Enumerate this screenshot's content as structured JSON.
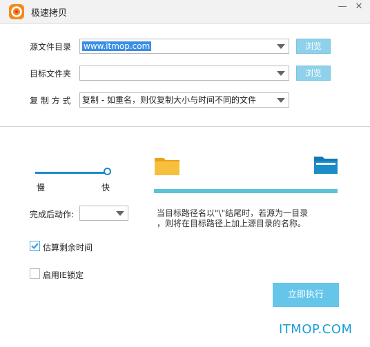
{
  "window": {
    "title": "极速拷贝",
    "minimize_glyph": "—",
    "close_glyph": "✕"
  },
  "source": {
    "label": "源文件目录",
    "value": "www.itmop.com",
    "browse_label": "浏览"
  },
  "target": {
    "label": "目标文件夹",
    "value": "",
    "browse_label": "浏览"
  },
  "copy_mode": {
    "label": "复 制 方 式",
    "value": "复制 - 如重名，则仅复制大小与时间不同的文件"
  },
  "speed": {
    "slow_label": "慢",
    "fast_label": "快",
    "level": 1.0
  },
  "progress": {
    "fraction": 1.0
  },
  "after_action": {
    "label": "完成后动作:",
    "value": ""
  },
  "hint": {
    "line1": "当目标路径名以\"\\\"结尾时，若源为一目录",
    "line2": "，则将在目标路径上加上源目录的名称。"
  },
  "estimate": {
    "label": "估算剩余时间",
    "checked": true
  },
  "ie_lock": {
    "label": "启用IE锁定",
    "checked": false
  },
  "execute_label": "立即执行",
  "watermark": "ITMOP.COM",
  "colors": {
    "accent": "#1e88c8",
    "button": "#8fd0ea",
    "execute": "#66c6ea",
    "progress": "#5bc4d6",
    "folder": "#f5b42e",
    "folder_blue": "#1c8cc8"
  }
}
